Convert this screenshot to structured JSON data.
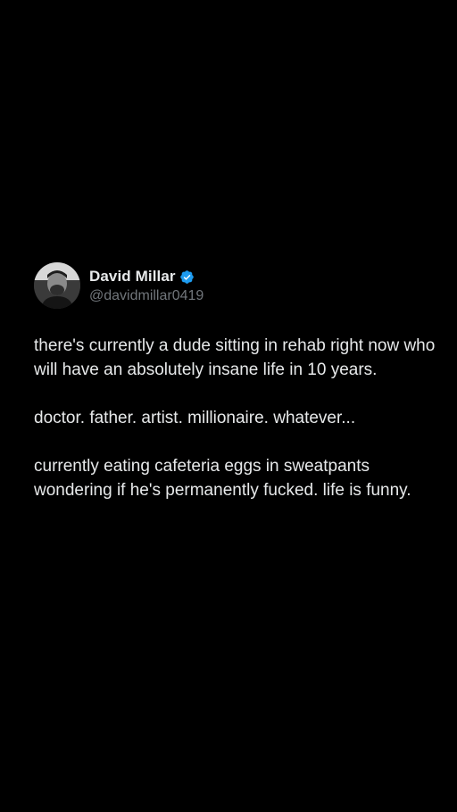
{
  "author": {
    "name": "David Millar",
    "handle": "@davidmillar0419",
    "verified": true,
    "avatar_icon": "profile-photo",
    "verified_icon": "verified-badge-icon",
    "verified_color": "#1d9bf0"
  },
  "tweet": {
    "paragraphs": [
      "there's currently a dude sitting in rehab right now who will have an absolutely insane life in 10 years.",
      "doctor. father. artist. millionaire. whatever...",
      "currently eating cafeteria eggs in sweatpants wondering if he's permanently fucked. life is funny."
    ]
  },
  "colors": {
    "background": "#000000",
    "text_primary": "#e7e9ea",
    "text_secondary": "#71767b"
  }
}
